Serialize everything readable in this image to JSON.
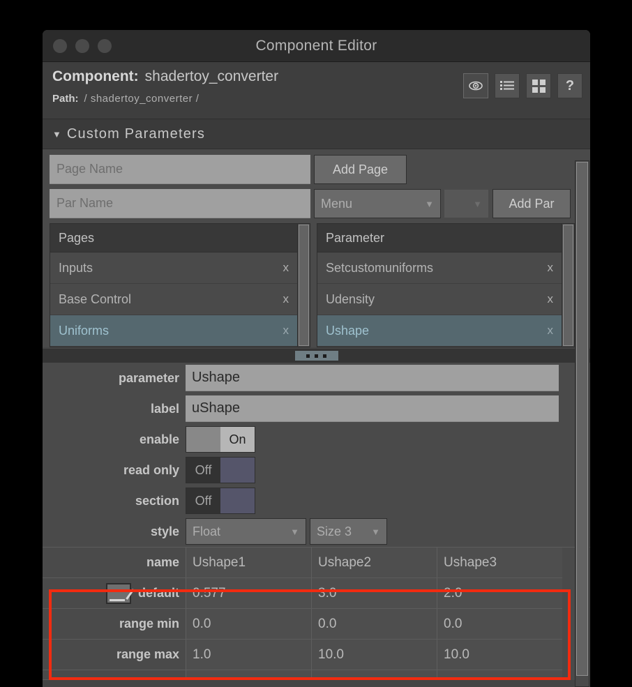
{
  "window": {
    "title": "Component Editor",
    "traffic_lights": [
      "close",
      "minimize",
      "zoom"
    ]
  },
  "header": {
    "component_key": "Component:",
    "component_value": "shadertoy_converter",
    "path_key": "Path:",
    "path_value": "/ shadertoy_converter /",
    "icons": [
      {
        "name": "viewer-icon",
        "glyph": "◉"
      },
      {
        "name": "list-icon",
        "glyph": "☰"
      },
      {
        "name": "grid-icon",
        "glyph": "▦"
      },
      {
        "name": "help-icon",
        "glyph": "?"
      }
    ]
  },
  "custom_parameters": {
    "section_title": "Custom Parameters",
    "collapse_triangle": "▼",
    "page_name_placeholder": "Page Name",
    "page_name_value": "",
    "add_page_label": "Add Page",
    "par_name_placeholder": "Par Name",
    "par_name_value": "",
    "par_type_value": "Menu",
    "par_size_value": "",
    "add_par_label": "Add Par",
    "caret": "▼"
  },
  "pages_list": {
    "header": "Pages",
    "items": [
      {
        "label": "Inputs",
        "remove": "x",
        "selected": false
      },
      {
        "label": "Base Control",
        "remove": "x",
        "selected": false
      },
      {
        "label": "Uniforms",
        "remove": "x",
        "selected": true
      }
    ]
  },
  "parameter_list": {
    "header": "Parameter",
    "items": [
      {
        "label": "Setcustomuniforms",
        "remove": "x",
        "selected": false
      },
      {
        "label": "Udensity",
        "remove": "x",
        "selected": false
      },
      {
        "label": "Ushape",
        "remove": "x",
        "selected": true
      }
    ]
  },
  "properties": {
    "parameter_label": "parameter",
    "parameter_value": "Ushape",
    "label_label": "label",
    "label_value": "uShape",
    "enable_label": "enable",
    "enable_value": "On",
    "read_only_label": "read only",
    "read_only_value": "Off",
    "section_label": "section",
    "section_value": "Off",
    "style_label": "style",
    "style_value": "Float",
    "size_value": "Size 3",
    "caret": "▼"
  },
  "table": {
    "rows": [
      {
        "label": "name",
        "icon": null,
        "cells": [
          "Ushape1",
          "Ushape2",
          "Ushape3"
        ]
      },
      {
        "label": "default",
        "icon": "clamp-icon",
        "cells": [
          "0.577",
          "3.0",
          "2.0"
        ]
      },
      {
        "label": "range min",
        "icon": null,
        "cells": [
          "0.0",
          "0.0",
          "0.0"
        ]
      },
      {
        "label": "range max",
        "icon": null,
        "cells": [
          "1.0",
          "10.0",
          "10.0"
        ]
      }
    ]
  },
  "highlight": {
    "color": "#f22b10",
    "note": "red annotation box around default / range min / range max rows"
  }
}
